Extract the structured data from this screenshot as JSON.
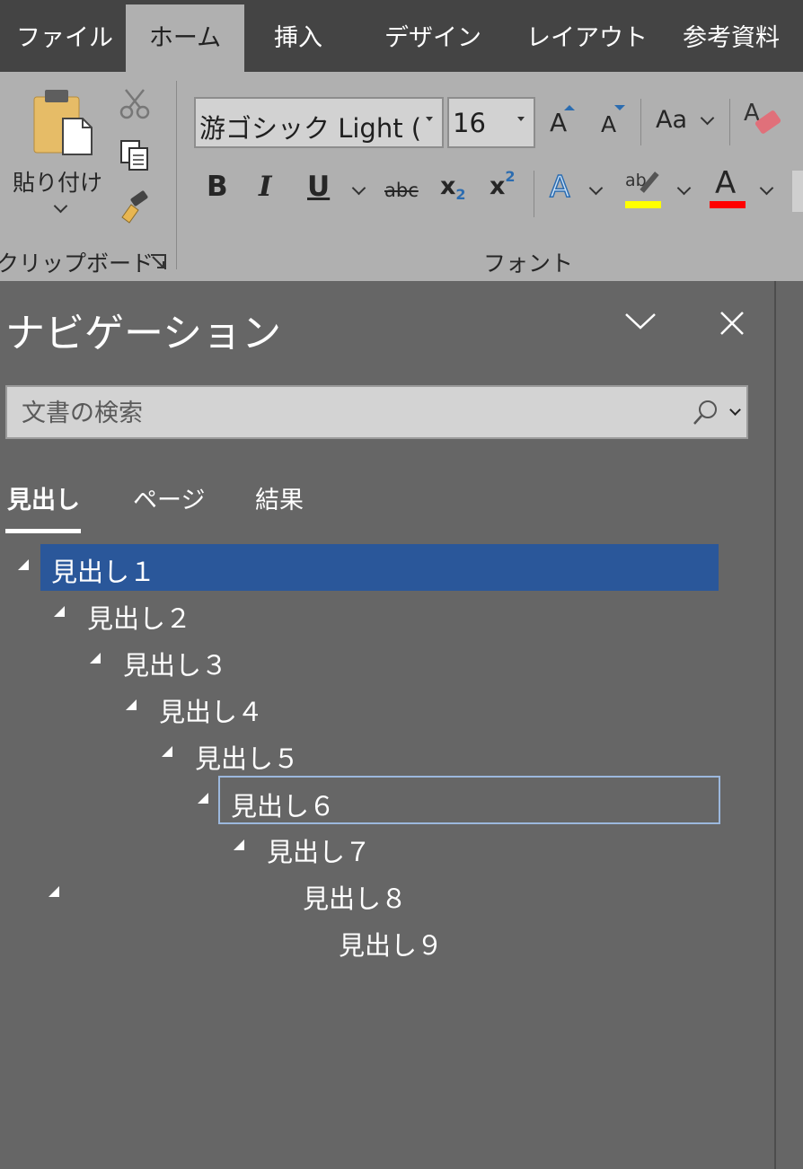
{
  "ribbon_tabs": [
    "ファイル",
    "ホーム",
    "挿入",
    "デザイン",
    "レイアウト",
    "参考資料"
  ],
  "active_tab": "ホーム",
  "clipboard": {
    "paste_label": "貼り付け",
    "group_label": "クリップボード",
    "icons": [
      "cut-icon",
      "copy-icon",
      "format-painter-icon",
      "dialog-launcher-icon"
    ]
  },
  "font": {
    "group_label": "フォント",
    "font_name": "游ゴシック Light (見",
    "font_size": "16",
    "grow_font": "A",
    "shrink_font": "A",
    "change_case": "Aa",
    "bold": "B",
    "italic": "I",
    "underline": "U",
    "strikethrough": "abc",
    "subscript_base": "x",
    "subscript_sub": "2",
    "superscript_base": "x",
    "superscript_sup": "2",
    "text_effects": "A",
    "highlight": "ab",
    "font_color": "A",
    "highlight_color": "#ffff00",
    "font_color_bar": "#ff0000"
  },
  "navigation": {
    "title": "ナビゲーション",
    "search_placeholder": "文書の検索",
    "tabs": [
      "見出し",
      "ページ",
      "結果"
    ],
    "active_tab": "見出し",
    "headings": [
      {
        "label": "見出し１",
        "level": 1,
        "expanded": true,
        "selected": true
      },
      {
        "label": "見出し２",
        "level": 2,
        "expanded": true
      },
      {
        "label": "見出し３",
        "level": 3,
        "expanded": true
      },
      {
        "label": "見出し４",
        "level": 4,
        "expanded": true
      },
      {
        "label": "見出し５",
        "level": 5,
        "expanded": true
      },
      {
        "label": "見出し６",
        "level": 6,
        "expanded": true,
        "focused": true
      },
      {
        "label": "見出し７",
        "level": 7,
        "expanded": true
      },
      {
        "label": "見出し８",
        "level": 8,
        "expanded": true
      },
      {
        "label": "見出し９",
        "level": 9
      }
    ],
    "accent_color": "#2a579a"
  }
}
